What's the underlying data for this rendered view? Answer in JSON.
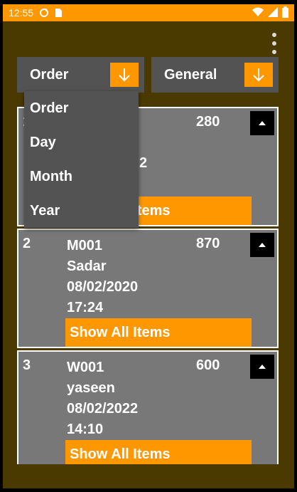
{
  "status_bar": {
    "time": "12:55",
    "icons": [
      "sync-icon",
      "sim-card-icon",
      "wifi-icon",
      "signal-icon",
      "battery-icon"
    ]
  },
  "colors": {
    "accent": "#ff9800",
    "background": "#4b3a00",
    "card": "#787878",
    "spinner": "#535353"
  },
  "filters": {
    "primary_selected": "Order",
    "secondary_selected": "General",
    "primary_options": [
      "Order",
      "Day",
      "Month",
      "Year"
    ]
  },
  "orders": [
    {
      "index": "1",
      "code": "",
      "name": "",
      "date": "",
      "time": "",
      "amount": "280",
      "button_label": "Show All Items",
      "partial_visible_date_tail": "2",
      "partial_visible_button_tail": "Items"
    },
    {
      "index": "2",
      "code": "M001",
      "name": "Sadar",
      "date": "08/02/2020",
      "time": "17:24",
      "amount": "870",
      "button_label": "Show All Items"
    },
    {
      "index": "3",
      "code": "W001",
      "name": "yaseen",
      "date": "08/02/2022",
      "time": "14:10",
      "amount": "600",
      "button_label": "Show All Items"
    }
  ]
}
